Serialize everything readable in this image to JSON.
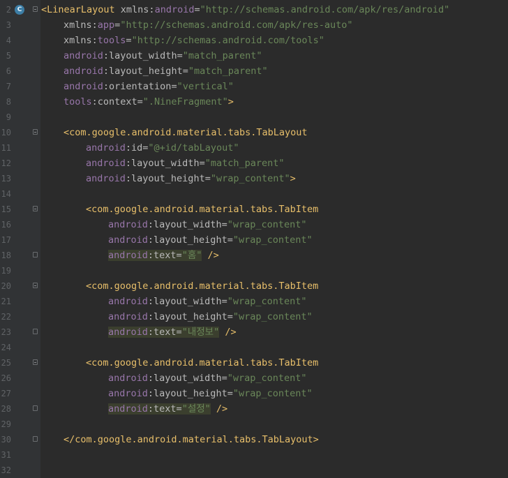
{
  "editor": {
    "gutter_icon_label": "C",
    "lines": [
      {
        "n": "2",
        "indent": 0,
        "fold": "open",
        "icon": true,
        "tokens": [
          {
            "t": "<LinearLayout ",
            "c": "tag"
          },
          {
            "t": "xmlns:",
            "c": "attr"
          },
          {
            "t": "android",
            "c": "ns"
          },
          {
            "t": "=",
            "c": "attr"
          },
          {
            "t": "\"http://schemas.android.com/apk/res/android\"",
            "c": "val"
          }
        ]
      },
      {
        "n": "3",
        "indent": 1,
        "tokens": [
          {
            "t": "xmlns:",
            "c": "attr"
          },
          {
            "t": "app",
            "c": "ns"
          },
          {
            "t": "=",
            "c": "attr"
          },
          {
            "t": "\"http://schemas.android.com/apk/res-auto\"",
            "c": "val"
          }
        ]
      },
      {
        "n": "4",
        "indent": 1,
        "tokens": [
          {
            "t": "xmlns:",
            "c": "attr"
          },
          {
            "t": "tools",
            "c": "ns"
          },
          {
            "t": "=",
            "c": "attr"
          },
          {
            "t": "\"http://schemas.android.com/tools\"",
            "c": "val"
          }
        ]
      },
      {
        "n": "5",
        "indent": 1,
        "tokens": [
          {
            "t": "android",
            "c": "ns"
          },
          {
            "t": ":layout_width=",
            "c": "attr"
          },
          {
            "t": "\"match_parent\"",
            "c": "val"
          }
        ]
      },
      {
        "n": "6",
        "indent": 1,
        "tokens": [
          {
            "t": "android",
            "c": "ns"
          },
          {
            "t": ":layout_height=",
            "c": "attr"
          },
          {
            "t": "\"match_parent\"",
            "c": "val"
          }
        ]
      },
      {
        "n": "7",
        "indent": 1,
        "tokens": [
          {
            "t": "android",
            "c": "ns"
          },
          {
            "t": ":orientation=",
            "c": "attr"
          },
          {
            "t": "\"vertical\"",
            "c": "val"
          }
        ]
      },
      {
        "n": "8",
        "indent": 1,
        "tokens": [
          {
            "t": "tools",
            "c": "ns"
          },
          {
            "t": ":context=",
            "c": "attr"
          },
          {
            "t": "\".NineFragment\"",
            "c": "val"
          },
          {
            "t": ">",
            "c": "punc"
          }
        ]
      },
      {
        "n": "9",
        "indent": 0,
        "tokens": []
      },
      {
        "n": "10",
        "indent": 1,
        "fold": "open",
        "tokens": [
          {
            "t": "<com.google.android.material.tabs.TabLayout",
            "c": "tag"
          }
        ]
      },
      {
        "n": "11",
        "indent": 2,
        "tokens": [
          {
            "t": "android",
            "c": "ns"
          },
          {
            "t": ":id=",
            "c": "attr"
          },
          {
            "t": "\"@+id/tabLayout\"",
            "c": "val"
          }
        ]
      },
      {
        "n": "12",
        "indent": 2,
        "tokens": [
          {
            "t": "android",
            "c": "ns"
          },
          {
            "t": ":layout_width=",
            "c": "attr"
          },
          {
            "t": "\"match_parent\"",
            "c": "val"
          }
        ]
      },
      {
        "n": "13",
        "indent": 2,
        "tokens": [
          {
            "t": "android",
            "c": "ns"
          },
          {
            "t": ":layout_height=",
            "c": "attr"
          },
          {
            "t": "\"wrap_content\"",
            "c": "val"
          },
          {
            "t": ">",
            "c": "punc"
          }
        ]
      },
      {
        "n": "14",
        "indent": 0,
        "tokens": []
      },
      {
        "n": "15",
        "indent": 2,
        "fold": "open",
        "tokens": [
          {
            "t": "<com.google.android.material.tabs.TabItem",
            "c": "tag"
          }
        ]
      },
      {
        "n": "16",
        "indent": 3,
        "tokens": [
          {
            "t": "android",
            "c": "ns"
          },
          {
            "t": ":layout_width=",
            "c": "attr"
          },
          {
            "t": "\"wrap_content\"",
            "c": "val"
          }
        ]
      },
      {
        "n": "17",
        "indent": 3,
        "tokens": [
          {
            "t": "android",
            "c": "ns"
          },
          {
            "t": ":layout_height=",
            "c": "attr"
          },
          {
            "t": "\"wrap_content\"",
            "c": "val"
          }
        ]
      },
      {
        "n": "18",
        "indent": 3,
        "fold": "close",
        "tokens": [
          {
            "t": "android",
            "c": "ns hl"
          },
          {
            "t": ":text=",
            "c": "attr hl"
          },
          {
            "t": "\"홈\"",
            "c": "val hl"
          },
          {
            "t": " />",
            "c": "punc"
          }
        ]
      },
      {
        "n": "19",
        "indent": 0,
        "tokens": []
      },
      {
        "n": "20",
        "indent": 2,
        "fold": "open",
        "tokens": [
          {
            "t": "<com.google.android.material.tabs.TabItem",
            "c": "tag"
          }
        ]
      },
      {
        "n": "21",
        "indent": 3,
        "tokens": [
          {
            "t": "android",
            "c": "ns"
          },
          {
            "t": ":layout_width=",
            "c": "attr"
          },
          {
            "t": "\"wrap_content\"",
            "c": "val"
          }
        ]
      },
      {
        "n": "22",
        "indent": 3,
        "tokens": [
          {
            "t": "android",
            "c": "ns"
          },
          {
            "t": ":layout_height=",
            "c": "attr"
          },
          {
            "t": "\"wrap_content\"",
            "c": "val"
          }
        ]
      },
      {
        "n": "23",
        "indent": 3,
        "fold": "close",
        "tokens": [
          {
            "t": "android",
            "c": "ns hl"
          },
          {
            "t": ":text=",
            "c": "attr hl"
          },
          {
            "t": "\"내정보\"",
            "c": "val hl"
          },
          {
            "t": " />",
            "c": "punc"
          }
        ]
      },
      {
        "n": "24",
        "indent": 0,
        "tokens": []
      },
      {
        "n": "25",
        "indent": 2,
        "fold": "open",
        "tokens": [
          {
            "t": "<com.google.android.material.tabs.TabItem",
            "c": "tag"
          }
        ]
      },
      {
        "n": "26",
        "indent": 3,
        "tokens": [
          {
            "t": "android",
            "c": "ns"
          },
          {
            "t": ":layout_width=",
            "c": "attr"
          },
          {
            "t": "\"wrap_content\"",
            "c": "val"
          }
        ]
      },
      {
        "n": "27",
        "indent": 3,
        "tokens": [
          {
            "t": "android",
            "c": "ns"
          },
          {
            "t": ":layout_height=",
            "c": "attr"
          },
          {
            "t": "\"wrap_content\"",
            "c": "val"
          }
        ]
      },
      {
        "n": "28",
        "indent": 3,
        "fold": "close",
        "tokens": [
          {
            "t": "android",
            "c": "ns hl"
          },
          {
            "t": ":text=",
            "c": "attr hl"
          },
          {
            "t": "\"설정\"",
            "c": "val hl"
          },
          {
            "t": " />",
            "c": "punc"
          }
        ]
      },
      {
        "n": "29",
        "indent": 0,
        "tokens": []
      },
      {
        "n": "30",
        "indent": 1,
        "fold": "close",
        "tokens": [
          {
            "t": "</com.google.android.material.tabs.TabLayout>",
            "c": "tag"
          }
        ]
      },
      {
        "n": "31",
        "indent": 0,
        "tokens": []
      },
      {
        "n": "32",
        "indent": 0,
        "tokens": []
      }
    ]
  }
}
